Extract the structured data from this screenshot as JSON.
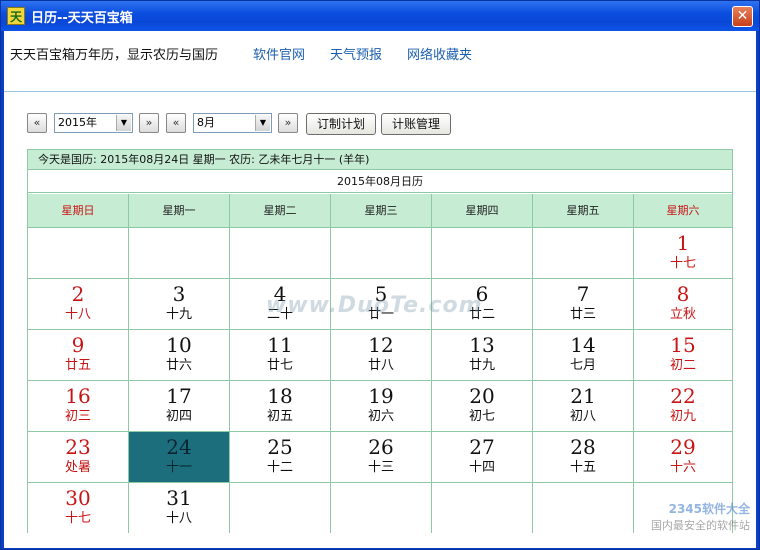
{
  "window": {
    "title": "日历--天天百宝箱",
    "icon_char": "天",
    "close_char": "✕"
  },
  "topmenu": {
    "brand": "天天百宝箱万年历，显示农历与国历",
    "links": [
      "软件官网",
      "天气预报",
      "网络收藏夹"
    ]
  },
  "toolbar": {
    "prev_year": "«",
    "next_year": "»",
    "prev_month": "«",
    "next_month": "»",
    "year_value": "2015年",
    "month_value": "8月",
    "plan_button": "订制计划",
    "accounts_button": "计账管理"
  },
  "calendar": {
    "info": "今天是国历: 2015年08月24日  星期一  农历: 乙未年七月十一 (羊年)",
    "month_label": "2015年08月日历",
    "weekdays": [
      "星期日",
      "星期一",
      "星期二",
      "星期三",
      "星期四",
      "星期五",
      "星期六"
    ],
    "weeks": [
      [
        null,
        null,
        null,
        null,
        null,
        null,
        {
          "d": "1",
          "l": "十七"
        }
      ],
      [
        {
          "d": "2",
          "l": "十八"
        },
        {
          "d": "3",
          "l": "十九"
        },
        {
          "d": "4",
          "l": "二十"
        },
        {
          "d": "5",
          "l": "廿一"
        },
        {
          "d": "6",
          "l": "廿二"
        },
        {
          "d": "7",
          "l": "廿三"
        },
        {
          "d": "8",
          "l": "立秋",
          "term": true
        }
      ],
      [
        {
          "d": "9",
          "l": "廿五"
        },
        {
          "d": "10",
          "l": "廿六"
        },
        {
          "d": "11",
          "l": "廿七"
        },
        {
          "d": "12",
          "l": "廿八"
        },
        {
          "d": "13",
          "l": "廿九"
        },
        {
          "d": "14",
          "l": "七月"
        },
        {
          "d": "15",
          "l": "初二"
        }
      ],
      [
        {
          "d": "16",
          "l": "初三"
        },
        {
          "d": "17",
          "l": "初四"
        },
        {
          "d": "18",
          "l": "初五"
        },
        {
          "d": "19",
          "l": "初六"
        },
        {
          "d": "20",
          "l": "初七"
        },
        {
          "d": "21",
          "l": "初八"
        },
        {
          "d": "22",
          "l": "初九"
        }
      ],
      [
        {
          "d": "23",
          "l": "处暑",
          "term": true
        },
        {
          "d": "24",
          "l": "十一",
          "today": true
        },
        {
          "d": "25",
          "l": "十二"
        },
        {
          "d": "26",
          "l": "十三"
        },
        {
          "d": "27",
          "l": "十四"
        },
        {
          "d": "28",
          "l": "十五"
        },
        {
          "d": "29",
          "l": "十六"
        }
      ],
      [
        {
          "d": "30",
          "l": "十七"
        },
        {
          "d": "31",
          "l": "十八"
        },
        null,
        null,
        null,
        null,
        null
      ]
    ]
  },
  "watermark": "www.DuoTe.com",
  "corner_mark": {
    "line1": "2345软件大全",
    "line2": "国内最安全的软件站"
  },
  "colors": {
    "header_green": "#c6ecd3",
    "grid_line": "#8fc8a4",
    "today_bg": "#1d6e7d",
    "weekend_red": "#c81414",
    "link_blue": "#1c5fb0"
  }
}
